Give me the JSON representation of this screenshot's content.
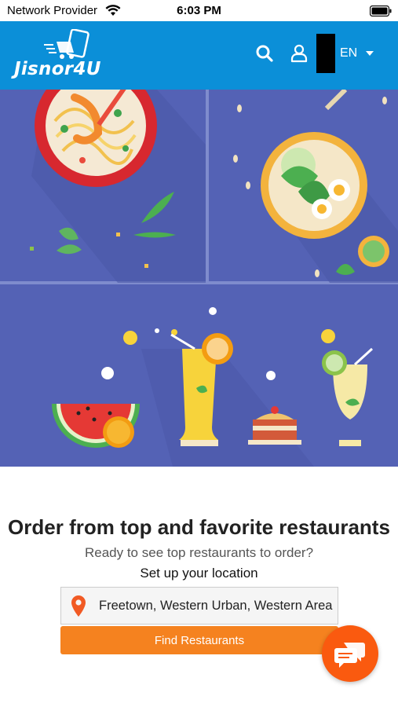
{
  "status_bar": {
    "carrier": "Network Provider",
    "time": "6:03 PM",
    "wifi_icon": "wifi-icon",
    "battery_icon": "battery-icon"
  },
  "header": {
    "logo_text": "Jisnor4U",
    "language": "EN",
    "icons": [
      "search-icon",
      "user-icon",
      "chevron-down-icon"
    ],
    "background_color": "#0b8fd8"
  },
  "hero": {
    "background_color": "#5462b5",
    "illustration": "food-and-drinks-illustration"
  },
  "main": {
    "title": "Order from top and favorite restaurants",
    "subtitle": "Ready to see top restaurants to order?",
    "setup_label": "Set up your location",
    "location_value": "Freetown, Western Urban, Western Area",
    "location_icon": "map-pin-icon",
    "find_button_label": "Find Restaurants",
    "accent_color": "#f5821f"
  },
  "chat": {
    "icon": "chat-icon",
    "color": "#fa5a0f"
  }
}
